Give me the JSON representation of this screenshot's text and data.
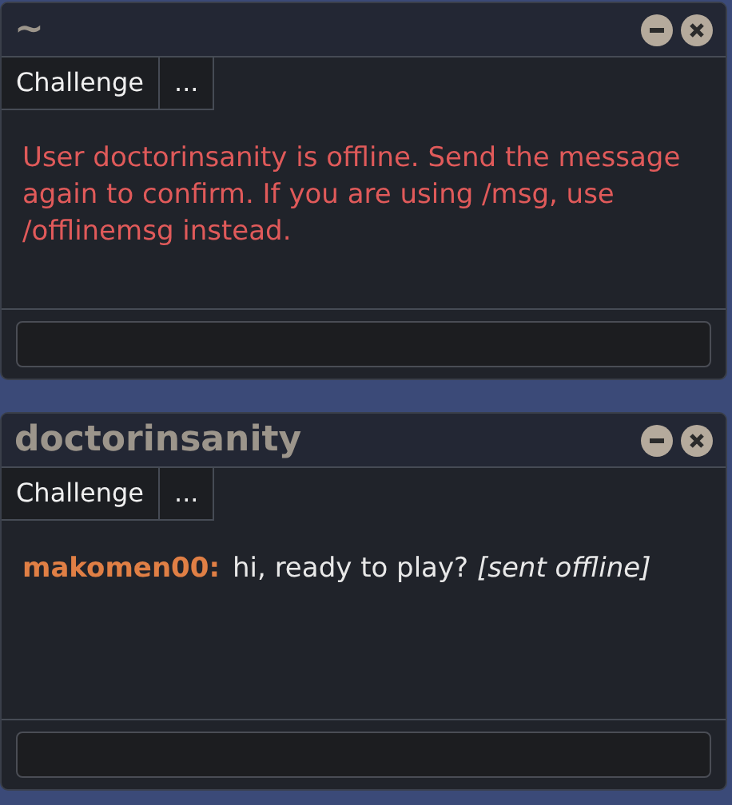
{
  "windows": [
    {
      "title": "~",
      "buttons": [
        "Challenge",
        "..."
      ],
      "messages": [
        {
          "kind": "error",
          "text": "User doctorinsanity is offline. Send the message again to confirm. If you are using /msg, use /offlinemsg instead."
        }
      ]
    },
    {
      "title": "doctorinsanity",
      "buttons": [
        "Challenge",
        "..."
      ],
      "messages": [
        {
          "kind": "chat",
          "user": "makomen00:",
          "text": "hi, ready to play? *[sent offline]*"
        }
      ]
    }
  ]
}
